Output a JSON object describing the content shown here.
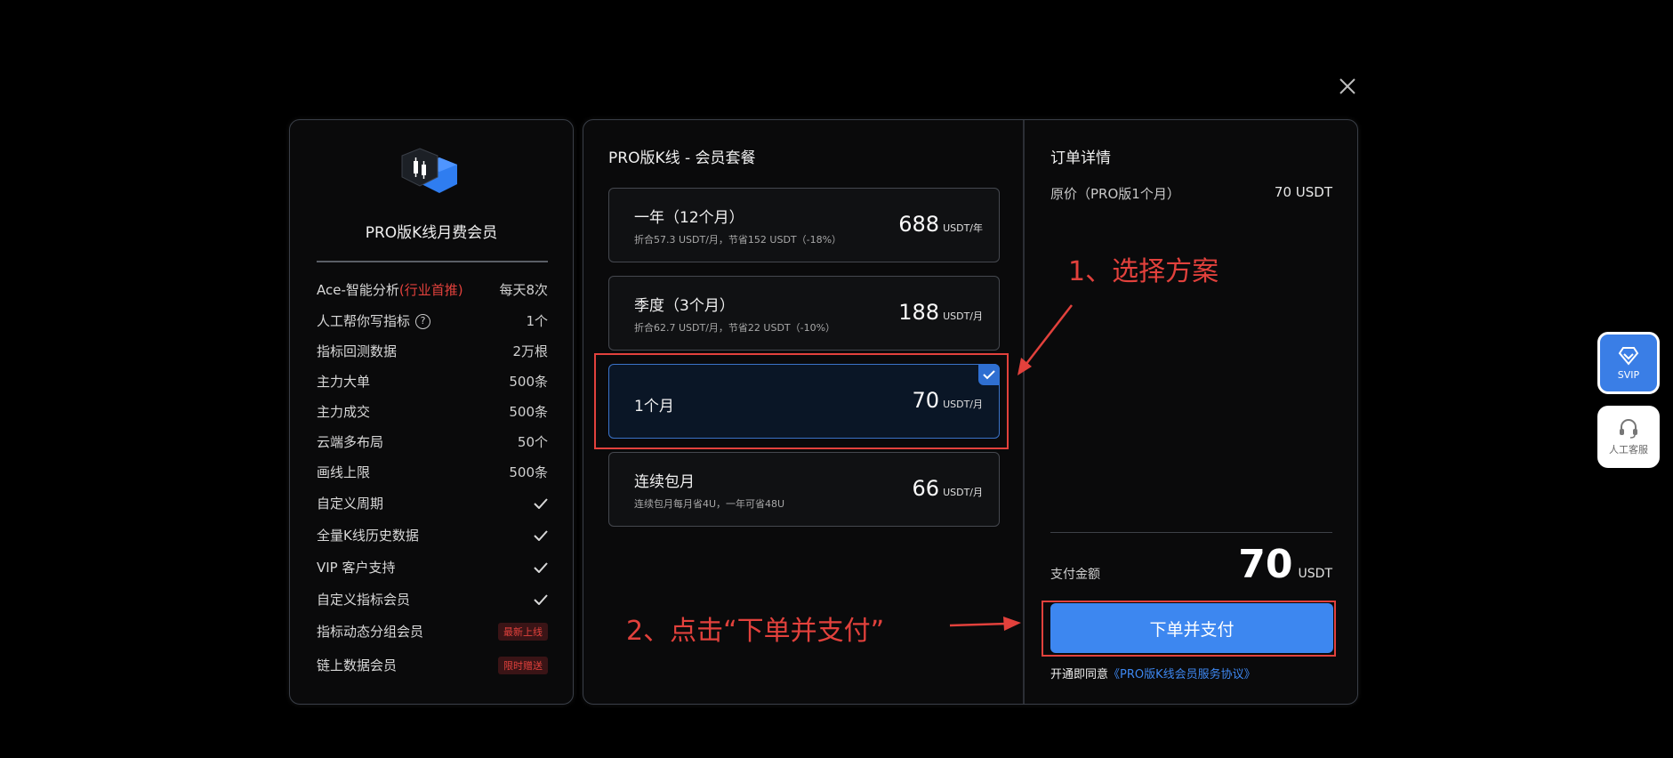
{
  "left": {
    "title": "PRO版K线月费会员",
    "features": [
      {
        "label": "Ace-智能分析",
        "highlight": "(行业首推)",
        "value": "每天8次"
      },
      {
        "label": "人工帮你写指标",
        "help": "?",
        "value": "1个"
      },
      {
        "label": "指标回测数据",
        "value": "2万根"
      },
      {
        "label": "主力大单",
        "value": "500条"
      },
      {
        "label": "主力成交",
        "value": "500条"
      },
      {
        "label": "云端多布局",
        "value": "50个"
      },
      {
        "label": "画线上限",
        "value": "500条"
      },
      {
        "label": "自定义周期",
        "value": "check-icon"
      },
      {
        "label": "全量K线历史数据",
        "value": "check-icon"
      },
      {
        "label": "VIP 客户支持",
        "value": "check-icon"
      },
      {
        "label": "自定义指标会员",
        "value": "check-icon"
      },
      {
        "label": "指标动态分组会员",
        "badge": "最新上线"
      },
      {
        "label": "链上数据会员",
        "badge": "限时赠送"
      }
    ]
  },
  "plans": {
    "title": "PRO版K线 - 会员套餐",
    "items": [
      {
        "name": "一年（12个月）",
        "desc": "折合57.3 USDT/月，节省152 USDT（-18%）",
        "price": "688",
        "unit": "USDT/年",
        "selected": false
      },
      {
        "name": "季度（3个月）",
        "desc": "折合62.7 USDT/月，节省22 USDT（-10%）",
        "price": "188",
        "unit": "USDT/月",
        "selected": false
      },
      {
        "name": "1个月",
        "desc": "",
        "price": "70",
        "unit": "USDT/月",
        "selected": true
      },
      {
        "name": "连续包月",
        "desc": "连续包月每月省4U，一年可省48U",
        "price": "66",
        "unit": "USDT/月",
        "selected": false
      }
    ]
  },
  "order": {
    "title": "订单详情",
    "orig_label": "原价（PRO版1个月）",
    "orig_value": "70 USDT",
    "pay_label": "支付金额",
    "pay_amount": "70",
    "pay_unit": "USDT",
    "pay_button": "下单并支付",
    "agree_prefix": "开通即同意",
    "agree_link": "《PRO版K线会员服务协议》"
  },
  "annotations": {
    "step1": "1、选择方案",
    "step2": "2、点击“下单并支付”"
  },
  "side": {
    "svip_label": "SVIP",
    "cs_label": "人工客服"
  },
  "colors": {
    "accent": "#3d87f0",
    "annotation": "#e2413c",
    "selected_border": "#3a73c9"
  }
}
